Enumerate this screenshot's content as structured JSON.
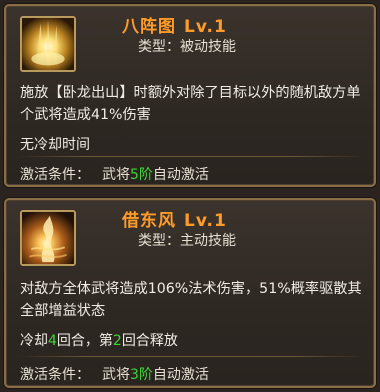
{
  "colors": {
    "title": "#ff9b2b",
    "highlight": "#3fd33a",
    "text": "#f0ece4",
    "border": "#8a6f46"
  },
  "skills": [
    {
      "icon": "golden-light-burst-icon",
      "name": "八阵图",
      "level": "Lv.1",
      "type": "类型：被动技能",
      "description": "施放【卧龙出山】时额外对除了目标以外的随机敌方单个武将造成41%伤害",
      "cooldown": {
        "text": "无冷却时间"
      },
      "activation": {
        "label": "激活条件：",
        "prefix": "武将",
        "stage": "5阶",
        "suffix": "自动激活"
      }
    },
    {
      "icon": "whirlwind-fire-icon",
      "name": "借东风",
      "level": "Lv.1",
      "type": "类型：主动技能",
      "description": "对敌方全体武将造成106%法术伤害，51%概率驱散其全部增益状态",
      "cooldown": {
        "pre": "冷却",
        "rounds": "4",
        "mid": "回合，第",
        "release_round": "2",
        "post": "回合释放"
      },
      "activation": {
        "label": "激活条件：",
        "prefix": "武将",
        "stage": "3阶",
        "suffix": "自动激活"
      }
    }
  ]
}
